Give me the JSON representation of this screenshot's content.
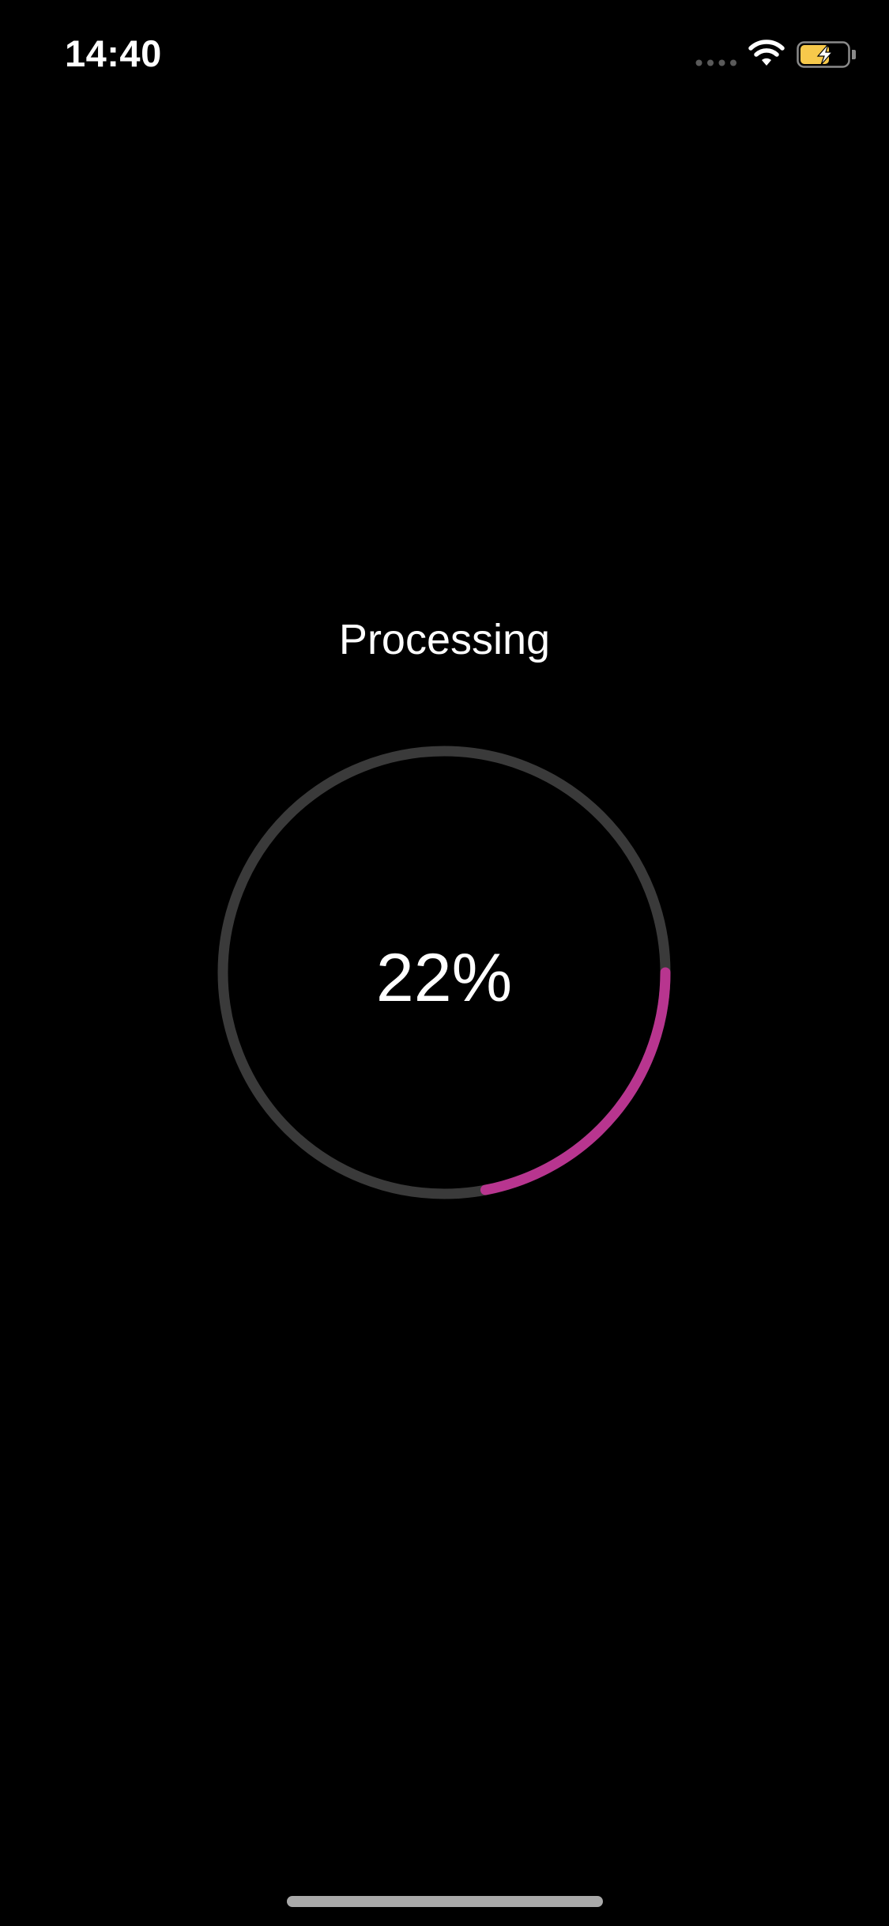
{
  "status_bar": {
    "time": "14:40",
    "icons": [
      "cellular-signal-icon",
      "wifi-icon",
      "battery-charging-icon"
    ]
  },
  "main": {
    "title": "Processing",
    "progress_text": "22%",
    "progress_fraction": 0.22
  },
  "colors": {
    "background": "#000000",
    "track": "#3a3a3a",
    "progress": "#b8358f",
    "battery_fill": "#f7c94b"
  }
}
